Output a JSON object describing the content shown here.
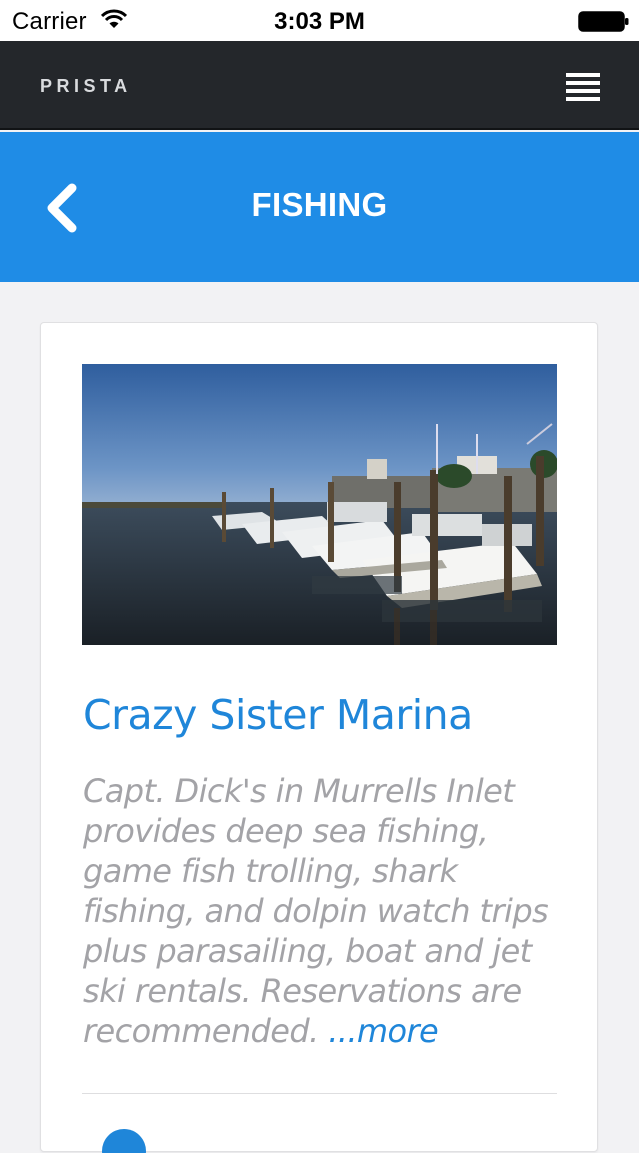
{
  "status_bar": {
    "carrier": "Carrier",
    "time": "3:03 PM",
    "icons": [
      "wifi-icon",
      "battery-icon"
    ]
  },
  "header": {
    "brand": "PRISTA",
    "menu_icon": "hamburger-menu-icon"
  },
  "banner": {
    "title": "FISHING",
    "back_icon": "chevron-left-icon"
  },
  "listing": {
    "image": "marina-photo",
    "title": "Crazy Sister Marina",
    "description": "Capt. Dick's in Murrells Inlet provides deep sea fishing, game fish trolling, shark fishing, and dolpin watch trips plus parasailing, boat and jet ski rentals. Reservations are recommended.",
    "more_label": "...more"
  },
  "colors": {
    "header_bg": "#24272b",
    "banner_bg": "#1f8ce6",
    "link": "#1f86d9",
    "body_text": "#a3a3a7",
    "page_bg": "#f2f2f4"
  }
}
